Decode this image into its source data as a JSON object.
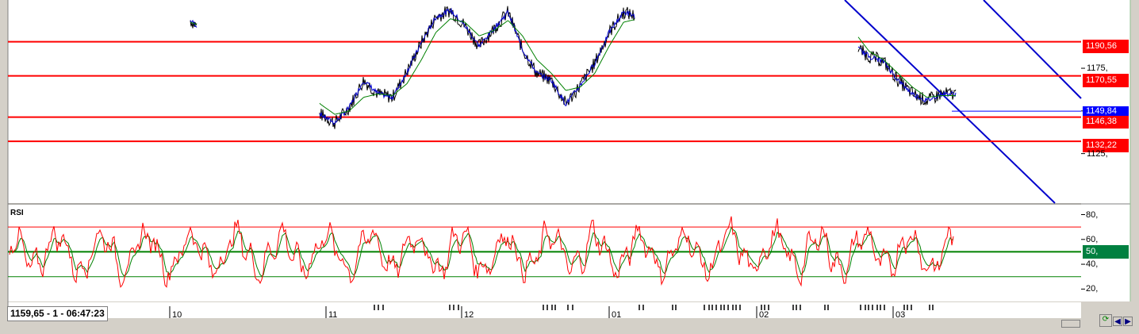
{
  "chart_data": [
    {
      "type": "line",
      "title": "",
      "ylim": [
        1096,
        1215
      ],
      "y_ticks": [
        "1175,",
        "1150,",
        "1125,"
      ],
      "y_tick_values": [
        1175,
        1150,
        1125
      ],
      "horizontal_levels": [
        {
          "label": "1190,56",
          "value": 1190.56,
          "color": "#ff0000"
        },
        {
          "label": "1170,55",
          "value": 1170.55,
          "color": "#ff0000"
        },
        {
          "label": "1146,38",
          "value": 1146.38,
          "color": "#ff0000"
        },
        {
          "label": "1132,22",
          "value": 1132.22,
          "color": "#ff0000"
        }
      ],
      "current_price": {
        "label": "1149,84",
        "value": 1149.84,
        "color": "#0000ff"
      },
      "series": [
        {
          "values": [
            1203,
            1196,
            1185,
            1205,
            1213,
            1208,
            1172,
            1166,
            1160,
            1148,
            1143,
            1152,
            1168,
            1160,
            1158,
            1173,
            1190,
            1205,
            1209,
            1200,
            1188,
            1198,
            1208,
            1186,
            1172,
            1168,
            1154,
            1165,
            1178,
            1196,
            1208,
            1205,
            1198,
            1190,
            1178,
            1186,
            1196,
            1190,
            1180,
            1184,
            1196,
            1205,
            1212,
            1210,
            1208,
            1206,
            1188,
            1182,
            1179,
            1168,
            1160,
            1156,
            1160,
            1160
          ]
        },
        {
          "values": [
            1202,
            1199,
            1195,
            1200,
            1206,
            1206,
            1186,
            1176,
            1166,
            1154,
            1148,
            1150,
            1158,
            1160,
            1159,
            1166,
            1180,
            1196,
            1204,
            1202,
            1194,
            1197,
            1203,
            1194,
            1180,
            1172,
            1162,
            1164,
            1172,
            1188,
            1202,
            1204,
            1200,
            1194,
            1184,
            1186,
            1192,
            1191,
            1184,
            1185,
            1192,
            1200,
            1208,
            1209,
            1208,
            1207,
            1196,
            1185,
            1180,
            1172,
            1164,
            1158,
            1159,
            1159
          ]
        }
      ],
      "colors": [
        "#000000",
        "#0000cc",
        "#008000"
      ]
    },
    {
      "type": "line",
      "title": "RSI",
      "ylim": [
        10,
        88
      ],
      "y_ticks": [
        "80,",
        "60,",
        "40,",
        "20,"
      ],
      "y_tick_values": [
        80,
        60,
        40,
        20
      ],
      "levels": [
        70,
        50,
        30
      ],
      "current_label": "50,",
      "colors": [
        "#ff0000",
        "#008000"
      ]
    }
  ],
  "x_axis": {
    "labels": [
      "10",
      "11",
      "12",
      "01",
      "02",
      "03"
    ]
  },
  "status_text": "1159,65 - 1 - 06:47:23"
}
